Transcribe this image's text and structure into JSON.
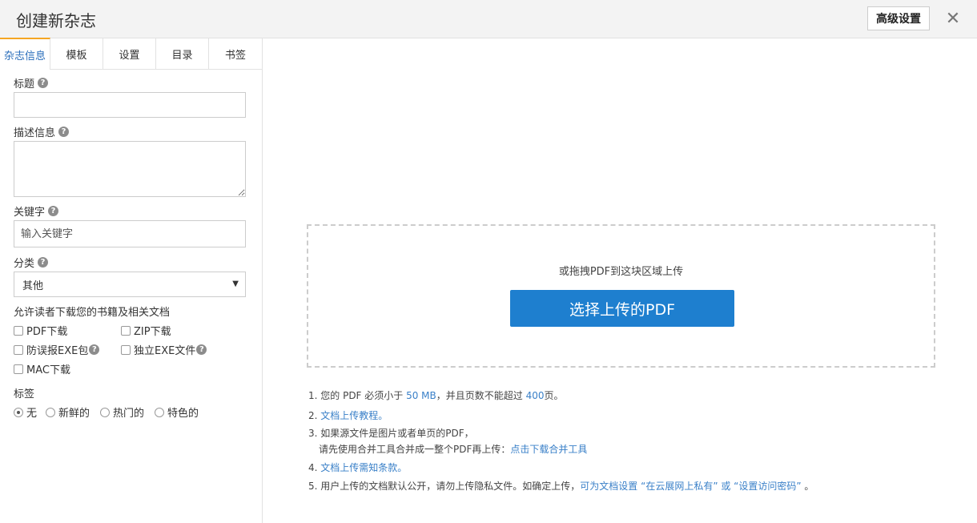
{
  "header": {
    "title": "创建新杂志",
    "advanced_label": "高级设置",
    "close_glyph": "✕"
  },
  "tabs": [
    {
      "label": "杂志信息",
      "active": true
    },
    {
      "label": "模板"
    },
    {
      "label": "设置"
    },
    {
      "label": "目录"
    },
    {
      "label": "书签"
    }
  ],
  "form": {
    "title_label": "标题",
    "title_value": "",
    "desc_label": "描述信息",
    "desc_value": "",
    "keyword_label": "关键字",
    "keyword_placeholder": "输入关键字",
    "category_label": "分类",
    "category_value": "其他",
    "download_label": "允许读者下载您的书籍及相关文档",
    "checkboxes": {
      "pdf": "PDF下载",
      "zip": "ZIP下载",
      "exe_pack": "防误报EXE包",
      "exe_file": "独立EXE文件",
      "mac": "MAC下载"
    },
    "tag_label": "标签",
    "tags": {
      "none": "无",
      "new": "新鲜的",
      "hot": "热门的",
      "special": "特色的"
    },
    "help_glyph": "?"
  },
  "upload": {
    "drop_text": "或拖拽PDF到这块区域上传",
    "button_label": "选择上传的PDF"
  },
  "notes": {
    "n1_a": "1. 您的 PDF 必须小于 ",
    "n1_size": "50 MB",
    "n1_b": "，并且页数不能超过 ",
    "n1_pages": "400",
    "n1_c": "页。",
    "n2_num": "2. ",
    "n2_link": "文档上传教程。",
    "n3_a": "3. 如果源文件是图片或者单页的PDF，",
    "n3_b": "请先使用合并工具合并成一整个PDF再上传：",
    "n3_link": "点击下载合并工具",
    "n4_num": "4. ",
    "n4_link": "文档上传需知条款。",
    "n5_a": "5. 用户上传的文档默认公开，请勿上传隐私文件。如确定上传，",
    "n5_link": "可为文档设置 “在云展网上私有” 或 “设置访问密码”",
    "n5_b": " 。"
  },
  "colors": {
    "accent": "#1e7fcf",
    "link": "#3a80c8",
    "tab_active_border": "#f5a623"
  }
}
